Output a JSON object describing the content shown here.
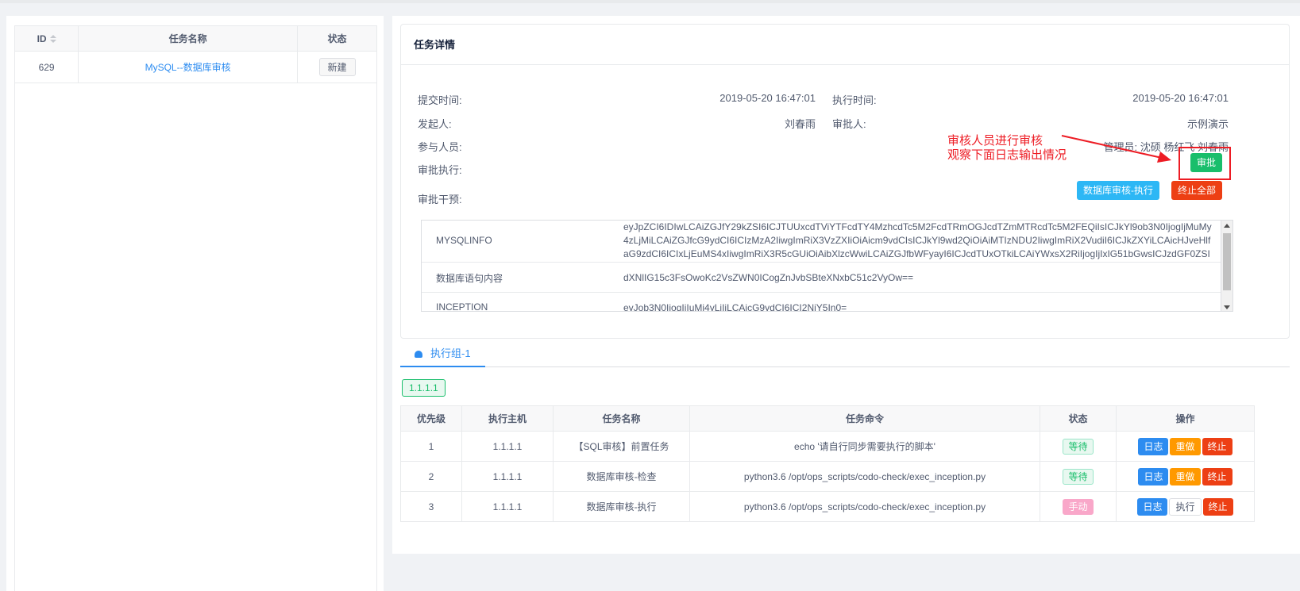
{
  "left_table": {
    "headers": {
      "id": "ID",
      "name": "任务名称",
      "status": "状态"
    },
    "rows": [
      {
        "id": "629",
        "name": "MySQL--数据库审核",
        "status": "新建"
      }
    ]
  },
  "detail": {
    "title": "任务详情",
    "submit_label": "提交时间:",
    "submit_value": "2019-05-20 16:47:01",
    "exec_label": "执行时间:",
    "exec_value": "2019-05-20 16:47:01",
    "initiator_label": "发起人:",
    "initiator_value": "刘春雨",
    "approver_label": "审批人:",
    "approver_value": "示例演示",
    "participants_label": "参与人员:",
    "participants_value": "管理员: 沈硕 杨红飞 刘春雨",
    "approve_exec_label": "审批执行:",
    "approve_button": "审批",
    "intervene_label": "审批干预:",
    "db_exec_button": "数据库审核-执行",
    "stop_all_button": "终止全部",
    "annotation_line1": "审核人员进行审核",
    "annotation_line2": "观察下面日志输出情况",
    "kv": [
      {
        "key": "MYSQLINFO",
        "value": "eyJpZCI6IDIwLCAiZGJfY29kZSI6ICJTUUxcdTViYTFcdTY4MzhcdTc5M2FcdTRmOGJcdTZmMTRcdTc5M2FEQiIsICJkYl9ob3N0IjogIjMuMy4zLjMiLCAiZGJfcG9ydCI6ICIzMzA2IiwgImRiX3VzZXIiOiAicm9vdCIsICJkYl9wd2QiOiAiMTIzNDU2IiwgImRiX2VudiI6ICJkZXYiLCAicHJveHlfaG9zdCI6ICIxLjEuMS4xIiwgImRiX3R5cGUiOiAibXlzcWwiLCAiZGJfbWFyayI6ICJcdTUxOTkiLCAiYWxsX2RiIjogIjIxIG51bGwsICJzdGF0ZSI6ICJ0cnVlIn0="
      },
      {
        "key": "数据库语句内容",
        "value": "dXNlIG15c3FsOwoKc2VsZWN0ICogZnJvbSBteXNxbC51c2VyOw=="
      },
      {
        "key": "INCEPTION",
        "value": "eyJob3N0IjogIjIuMi4yLjIiLCAicG9ydCI6ICI2NjY5In0="
      }
    ]
  },
  "tabs": [
    {
      "label": "执行组-1",
      "icon": "cloud-icon"
    }
  ],
  "ip_tag": "1.1.1.1",
  "exec_table": {
    "headers": [
      "优先级",
      "执行主机",
      "任务名称",
      "任务命令",
      "状态",
      "操作"
    ],
    "rows": [
      {
        "priority": "1",
        "host": "1.1.1.1",
        "name": "【SQL审核】前置任务",
        "command": "echo '请自行同步需要执行的脚本'",
        "status": "等待",
        "status_type": "wait",
        "log": "日志",
        "redo": "重做",
        "stop": "终止",
        "redo_style": "orange"
      },
      {
        "priority": "2",
        "host": "1.1.1.1",
        "name": "数据库审核-检查",
        "command": "python3.6 /opt/ops_scripts/codo-check/exec_inception.py",
        "status": "等待",
        "status_type": "wait",
        "log": "日志",
        "redo": "重做",
        "stop": "终止",
        "redo_style": "orange"
      },
      {
        "priority": "3",
        "host": "1.1.1.1",
        "name": "数据库审核-执行",
        "command": "python3.6 /opt/ops_scripts/codo-check/exec_inception.py",
        "status": "手动",
        "status_type": "manual",
        "log": "日志",
        "redo": "执行",
        "stop": "终止",
        "redo_style": "default"
      }
    ]
  },
  "colors": {
    "primary": "#2d8cf0",
    "success": "#19be6b",
    "error": "#ed3f14",
    "warning": "#ff9900",
    "annotation": "#ed1c24"
  }
}
